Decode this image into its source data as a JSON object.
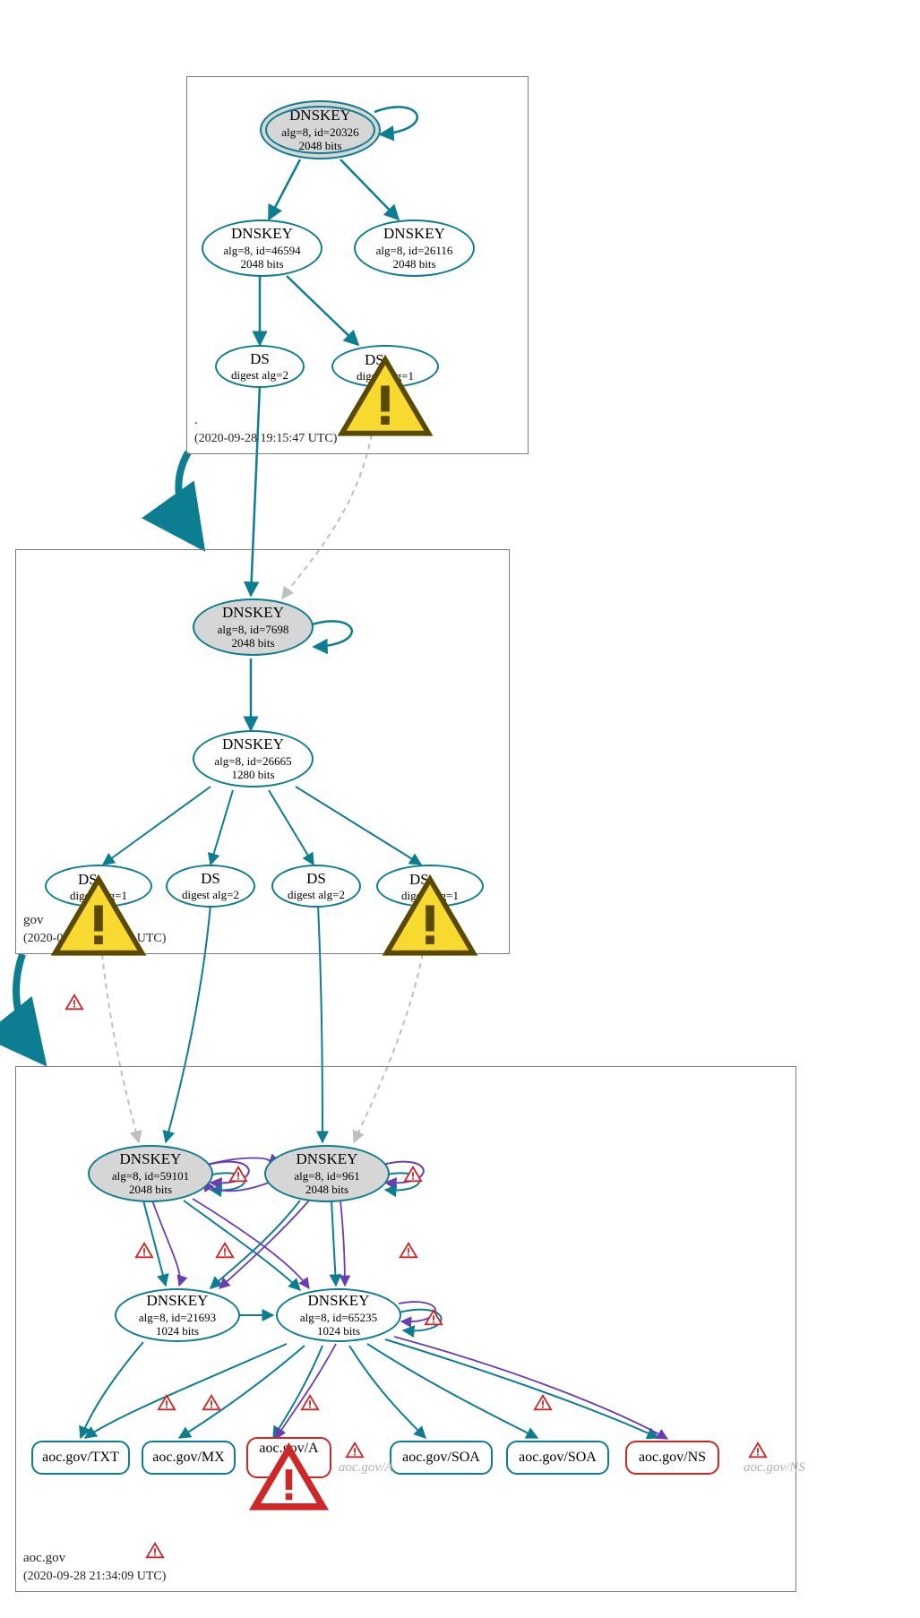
{
  "zones": {
    "root": {
      "name": ".",
      "timestamp": "(2020-09-28 19:15:47 UTC)"
    },
    "gov": {
      "name": "gov",
      "timestamp": "(2020-09-28 21:24:15 UTC)"
    },
    "aoc": {
      "name": "aoc.gov",
      "timestamp": "(2020-09-28 21:34:09 UTC)"
    }
  },
  "nodes": {
    "root_ksk": {
      "title": "DNSKEY",
      "line1": "alg=8, id=20326",
      "line2": "2048 bits"
    },
    "root_zsk1": {
      "title": "DNSKEY",
      "line1": "alg=8, id=46594",
      "line2": "2048 bits"
    },
    "root_zsk2": {
      "title": "DNSKEY",
      "line1": "alg=8, id=26116",
      "line2": "2048 bits"
    },
    "root_ds1": {
      "title": "DS",
      "line1": "digest alg=2"
    },
    "root_ds2": {
      "title": "DS",
      "line1": "digest alg=1"
    },
    "gov_ksk": {
      "title": "DNSKEY",
      "line1": "alg=8, id=7698",
      "line2": "2048 bits"
    },
    "gov_zsk": {
      "title": "DNSKEY",
      "line1": "alg=8, id=26665",
      "line2": "1280 bits"
    },
    "gov_ds1": {
      "title": "DS",
      "line1": "digest alg=1"
    },
    "gov_ds2": {
      "title": "DS",
      "line1": "digest alg=2"
    },
    "gov_ds3": {
      "title": "DS",
      "line1": "digest alg=2"
    },
    "gov_ds4": {
      "title": "DS",
      "line1": "digest alg=1"
    },
    "aoc_ksk1": {
      "title": "DNSKEY",
      "line1": "alg=8, id=59101",
      "line2": "2048 bits"
    },
    "aoc_ksk2": {
      "title": "DNSKEY",
      "line1": "alg=8, id=961",
      "line2": "2048 bits"
    },
    "aoc_zsk1": {
      "title": "DNSKEY",
      "line1": "alg=8, id=21693",
      "line2": "1024 bits"
    },
    "aoc_zsk2": {
      "title": "DNSKEY",
      "line1": "alg=8, id=65235",
      "line2": "1024 bits"
    }
  },
  "rr": {
    "txt": "aoc.gov/TXT",
    "mx": "aoc.gov/MX",
    "a": "aoc.gov/A",
    "soa1": "aoc.gov/SOA",
    "soa2": "aoc.gov/SOA",
    "ns": "aoc.gov/NS"
  },
  "ghosts": {
    "a": "aoc.gov/A",
    "ns": "aoc.gov/NS"
  },
  "colors": {
    "teal": "#0d7d91",
    "purple": "#6a3db3",
    "grey": "#bfbfbf",
    "error": "#cc2828",
    "warn_fill": "#f7d92f"
  }
}
